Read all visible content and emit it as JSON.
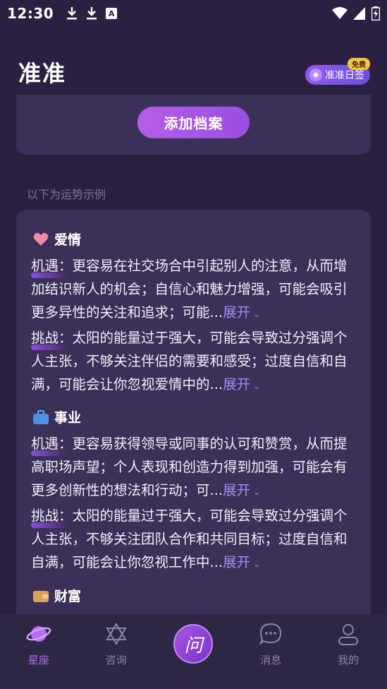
{
  "status_bar": {
    "time": "12:30",
    "a_icon_text": "A"
  },
  "header": {
    "title": "准准",
    "daily_button": "准准日签",
    "free_badge": "免费"
  },
  "add_profile": {
    "button_label": "添加档案"
  },
  "example_note": "以下为运势示例",
  "sections": [
    {
      "title": "爱情",
      "icon": "heart-icon",
      "paragraphs": [
        {
          "label": "机遇：",
          "text": "更容易在社交场合中引起别人的注意，从而增加结识新人的机会；自信心和魅力增强，可能会吸引更多异性的关注和追求；可能...",
          "expand": "展开"
        },
        {
          "label": "挑战：",
          "text": "太阳的能量过于强大，可能会导致过分强调个人主张，不够关注伴侣的需要和感受；过度自信和自满，可能会让你忽视爱情中的...",
          "expand": "展开"
        }
      ]
    },
    {
      "title": "事业",
      "icon": "briefcase-icon",
      "paragraphs": [
        {
          "label": "机遇：",
          "text": "更容易获得领导或同事的认可和赞赏，从而提高职场声望；个人表现和创造力得到加强，可能会有更多创新性的想法和行动；可...",
          "expand": "展开"
        },
        {
          "label": "挑战：",
          "text": "太阳的能量过于强大，可能会导致过分强调个人主张，不够关注团队合作和共同目标；过度自信和自满，可能会让你忽视工作中...",
          "expand": "展开"
        }
      ]
    },
    {
      "title": "财富",
      "icon": "wallet-icon",
      "paragraphs": []
    }
  ],
  "bottom_nav": [
    {
      "label": "星座",
      "icon": "planet-icon",
      "active": true
    },
    {
      "label": "咨询",
      "icon": "hexagram-icon",
      "active": false
    },
    {
      "label": "问",
      "icon": "ask-icon",
      "active": false
    },
    {
      "label": "消息",
      "icon": "chat-bubble-icon",
      "active": false
    },
    {
      "label": "我的",
      "icon": "user-icon",
      "active": false
    }
  ],
  "colors": {
    "background": "#2a2142",
    "card": "#3a3058",
    "accent": "#b56ef0",
    "expand_link": "#a88bf0"
  }
}
